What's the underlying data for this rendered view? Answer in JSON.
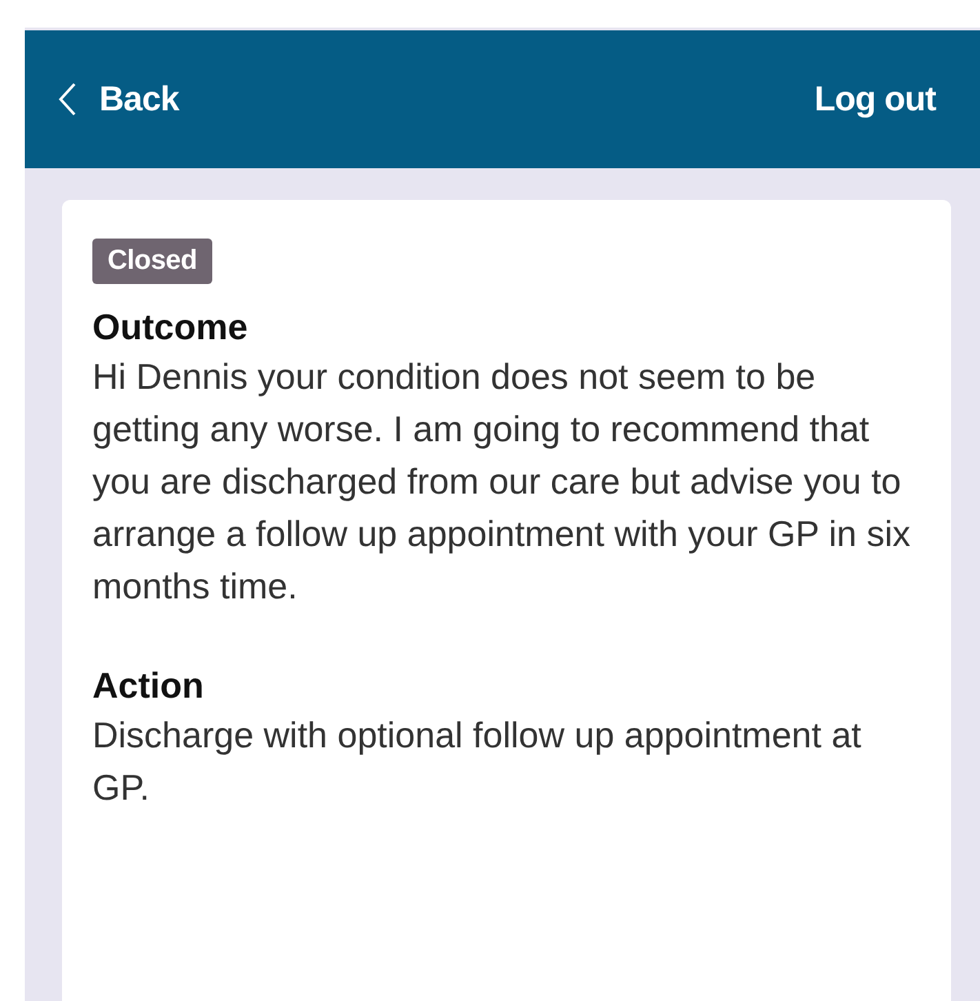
{
  "header": {
    "back": "Back",
    "logout": "Log out"
  },
  "case": {
    "status": "Closed",
    "sections": [
      {
        "heading": "Outcome",
        "body": "Hi Dennis your condition does not seem to be getting any worse. I am going to recommend that you are discharged from our care but advise you to arrange a follow up appointment with your GP in six months time."
      },
      {
        "heading": "Action",
        "body": "Discharge with optional follow up appointment at GP."
      }
    ]
  }
}
